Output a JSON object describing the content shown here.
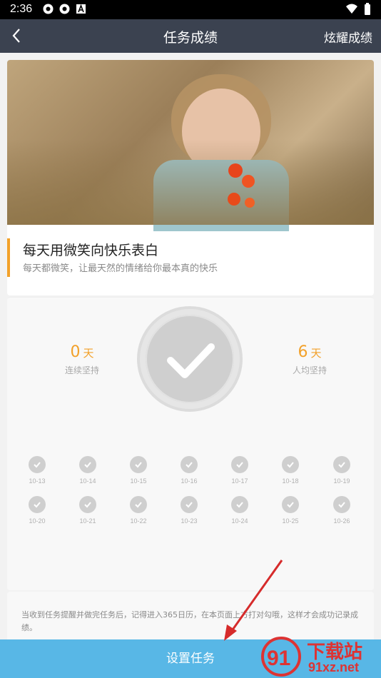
{
  "status_bar": {
    "time": "2:36"
  },
  "header": {
    "title": "任务成绩",
    "right_action": "炫耀成绩"
  },
  "task": {
    "title": "每天用微笑向快乐表白",
    "subtitle": "每天都微笑，让最天然的情绪给你最本真的快乐"
  },
  "stats": {
    "streak_value": "0",
    "streak_unit": "天",
    "streak_label": "连续坚持",
    "average_value": "6",
    "average_unit": "天",
    "average_label": "人均坚持"
  },
  "calendar": {
    "dates": [
      "10-13",
      "10-14",
      "10-15",
      "10-16",
      "10-17",
      "10-18",
      "10-19",
      "10-20",
      "10-21",
      "10-22",
      "10-23",
      "10-24",
      "10-25",
      "10-26"
    ]
  },
  "note": "当收到任务提醒并做完任务后，记得进入365日历，在本页面上方打对勾哦，这样才会成功记录成绩。",
  "bottom_button": "设置任务",
  "watermark": {
    "text": "下载站",
    "url": "91xz.net"
  }
}
